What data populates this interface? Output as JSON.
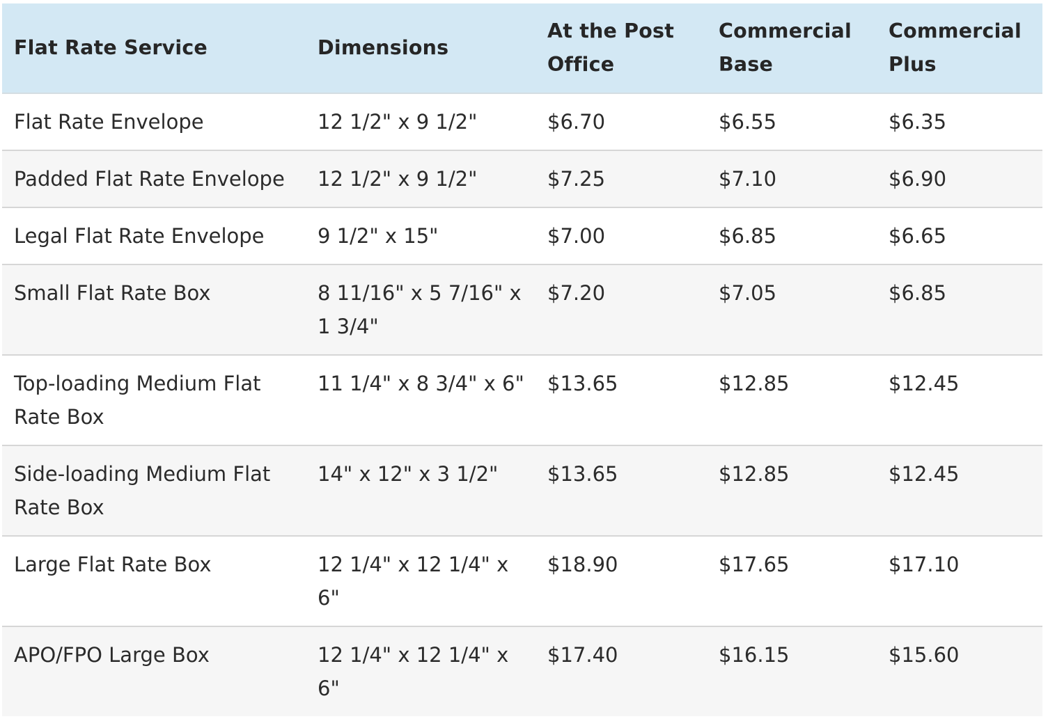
{
  "table": {
    "headers": [
      "Flat Rate Service",
      "Dimensions",
      "At the Post Office",
      "Commercial Base",
      "Commercial Plus"
    ],
    "rows": [
      {
        "service": "Flat Rate Envelope",
        "dimensions": "12 1/2\" x 9 1/2\"",
        "post_office": "$6.70",
        "commercial_base": "$6.55",
        "commercial_plus": "$6.35"
      },
      {
        "service": "Padded Flat Rate Envelope",
        "dimensions": "12 1/2\" x 9 1/2\"",
        "post_office": "$7.25",
        "commercial_base": "$7.10",
        "commercial_plus": "$6.90"
      },
      {
        "service": "Legal Flat Rate Envelope",
        "dimensions": "9 1/2\" x 15\"",
        "post_office": "$7.00",
        "commercial_base": "$6.85",
        "commercial_plus": "$6.65"
      },
      {
        "service": "Small Flat Rate Box",
        "dimensions": "8 11/16\" x 5 7/16\" x 1 3/4\"",
        "post_office": "$7.20",
        "commercial_base": "$7.05",
        "commercial_plus": "$6.85"
      },
      {
        "service": "Top-loading Medium Flat Rate Box",
        "dimensions": "11 1/4\" x 8 3/4\" x 6\"",
        "post_office": "$13.65",
        "commercial_base": "$12.85",
        "commercial_plus": "$12.45"
      },
      {
        "service": "Side-loading Medium Flat Rate Box",
        "dimensions": "14\" x 12\" x 3 1/2\"",
        "post_office": "$13.65",
        "commercial_base": "$12.85",
        "commercial_plus": "$12.45"
      },
      {
        "service": "Large Flat Rate Box",
        "dimensions": "12 1/4\" x 12 1/4\" x 6\"",
        "post_office": "$18.90",
        "commercial_base": "$17.65",
        "commercial_plus": "$17.10"
      },
      {
        "service": "APO/FPO Large Box",
        "dimensions": "12 1/4\" x 12 1/4\" x 6\"",
        "post_office": "$17.40",
        "commercial_base": "$16.15",
        "commercial_plus": "$15.60"
      }
    ]
  },
  "colors": {
    "header_background": "#d3e8f4",
    "row_alt_background": "#f6f6f6",
    "row_border": "#d6d6d6"
  }
}
